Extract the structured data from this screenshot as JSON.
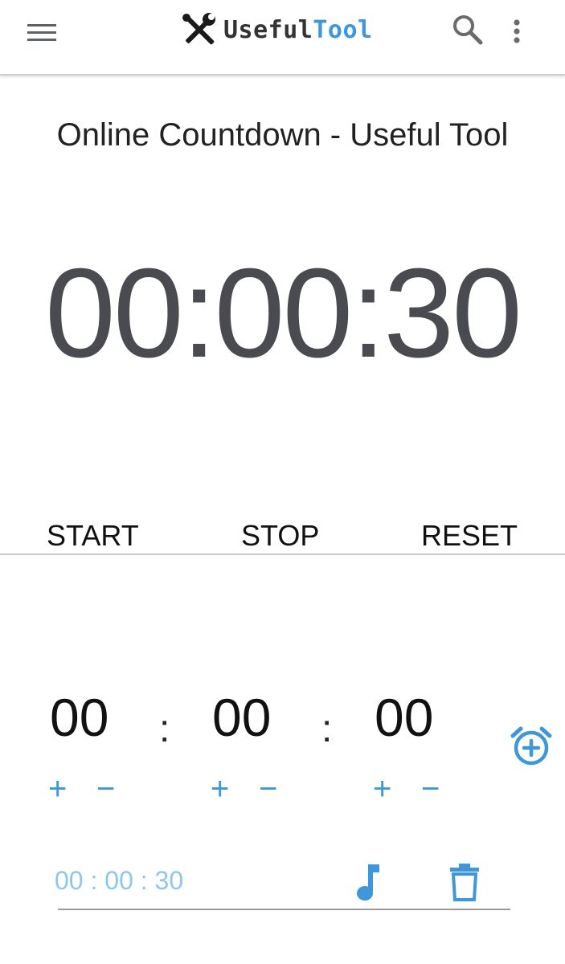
{
  "header": {
    "brand_part1": "Useful",
    "brand_part2": "Tool",
    "brand_color_primary": "#333333",
    "brand_color_accent": "#3e97d8",
    "menu_icon": "hamburger-menu-icon",
    "logo_icon": "tools-icon",
    "search_icon": "search-icon",
    "more_icon": "more-vert-icon"
  },
  "main": {
    "title": "Online Countdown - Useful Tool",
    "timer_display": "00:00:30",
    "controls": {
      "start": "START",
      "stop": "STOP",
      "reset": "RESET"
    }
  },
  "setter": {
    "hours": "00",
    "minutes": "00",
    "seconds": "00",
    "separator": ":",
    "plus": "+",
    "minus": "−",
    "add_alarm_icon": "alarm-add-icon"
  },
  "preset": {
    "label": "00 : 00 : 30",
    "music_icon": "music-note-icon",
    "delete_icon": "trash-icon"
  },
  "colors": {
    "accent": "#3e97d8",
    "preset_text": "#8fc6ee",
    "timer_text": "#4a4b50"
  }
}
